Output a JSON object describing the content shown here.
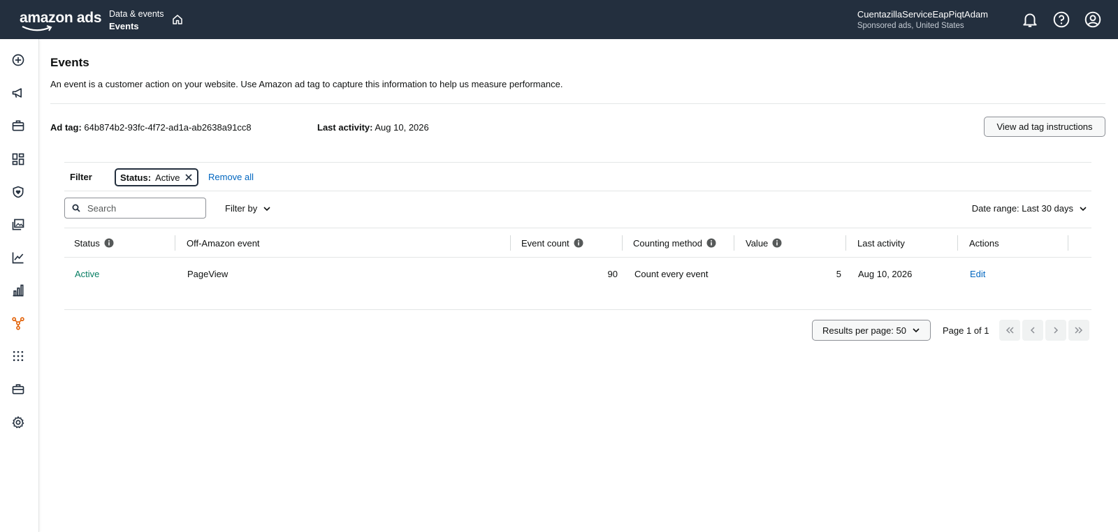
{
  "header": {
    "logo": "amazon ads",
    "breadcrumb_parent": "Data & events",
    "breadcrumb_current": "Events",
    "account_name": "CuentazillaServiceEapPiqtAdam",
    "account_sub": "Sponsored ads, United States"
  },
  "page": {
    "title": "Events",
    "description": "An event is a customer action on your website. Use Amazon ad tag to capture this information to help us measure performance.",
    "ad_tag_label": "Ad tag:",
    "ad_tag_value": "64b874b2-93fc-4f72-ad1a-ab2638a91cc8",
    "last_activity_label": "Last activity:",
    "last_activity_value": "Aug 10, 2026",
    "instructions_button": "View ad tag instructions"
  },
  "filter": {
    "label": "Filter",
    "chip_key": "Status:",
    "chip_value": "Active",
    "remove_all": "Remove all"
  },
  "toolbar": {
    "search_placeholder": "Search",
    "filter_by": "Filter by",
    "date_range": "Date range: Last 30 days"
  },
  "table": {
    "columns": [
      "Status",
      "Off-Amazon event",
      "Event count",
      "Counting method",
      "Value",
      "Last activity",
      "Actions"
    ],
    "rows": [
      {
        "status": "Active",
        "event": "PageView",
        "count": "90",
        "method": "Count every event",
        "value": "5",
        "last_activity": "Aug 10, 2026",
        "action": "Edit"
      }
    ]
  },
  "pagination": {
    "results_per_page": "Results per page: 50",
    "page_of": "Page 1 of 1"
  },
  "colors": {
    "header_bg": "#232f3e",
    "link": "#0066c0",
    "active_status": "#067d62",
    "accent_rail": "#e3640b"
  }
}
